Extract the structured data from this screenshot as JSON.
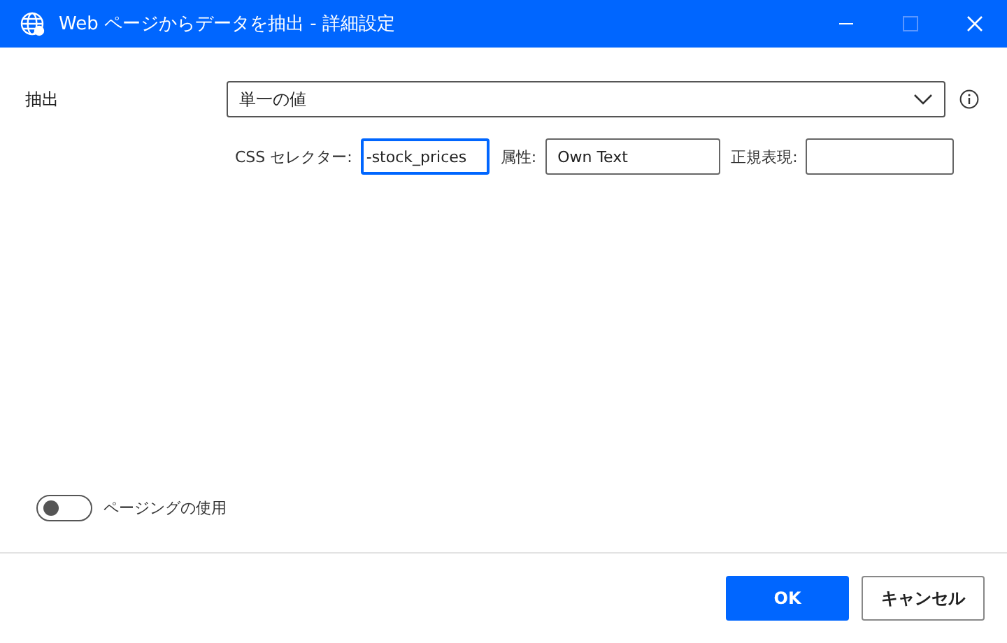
{
  "window": {
    "title": "Web ページからデータを抽出 - 詳細設定"
  },
  "extract": {
    "label": "抽出",
    "value": "単一の値"
  },
  "fields": [
    {
      "label": "CSS セレクター:",
      "value": "-stock_prices",
      "focused": true
    },
    {
      "label": "属性:",
      "value": "Own Text",
      "focused": false
    },
    {
      "label": "正規表現:",
      "focused": false
    }
  ],
  "paging": {
    "label": "ページングの使用",
    "on": false
  },
  "buttons": [
    {
      "label": "OK",
      "kind": "primary"
    },
    {
      "label": "キャンセル",
      "kind": "secondary"
    }
  ]
}
